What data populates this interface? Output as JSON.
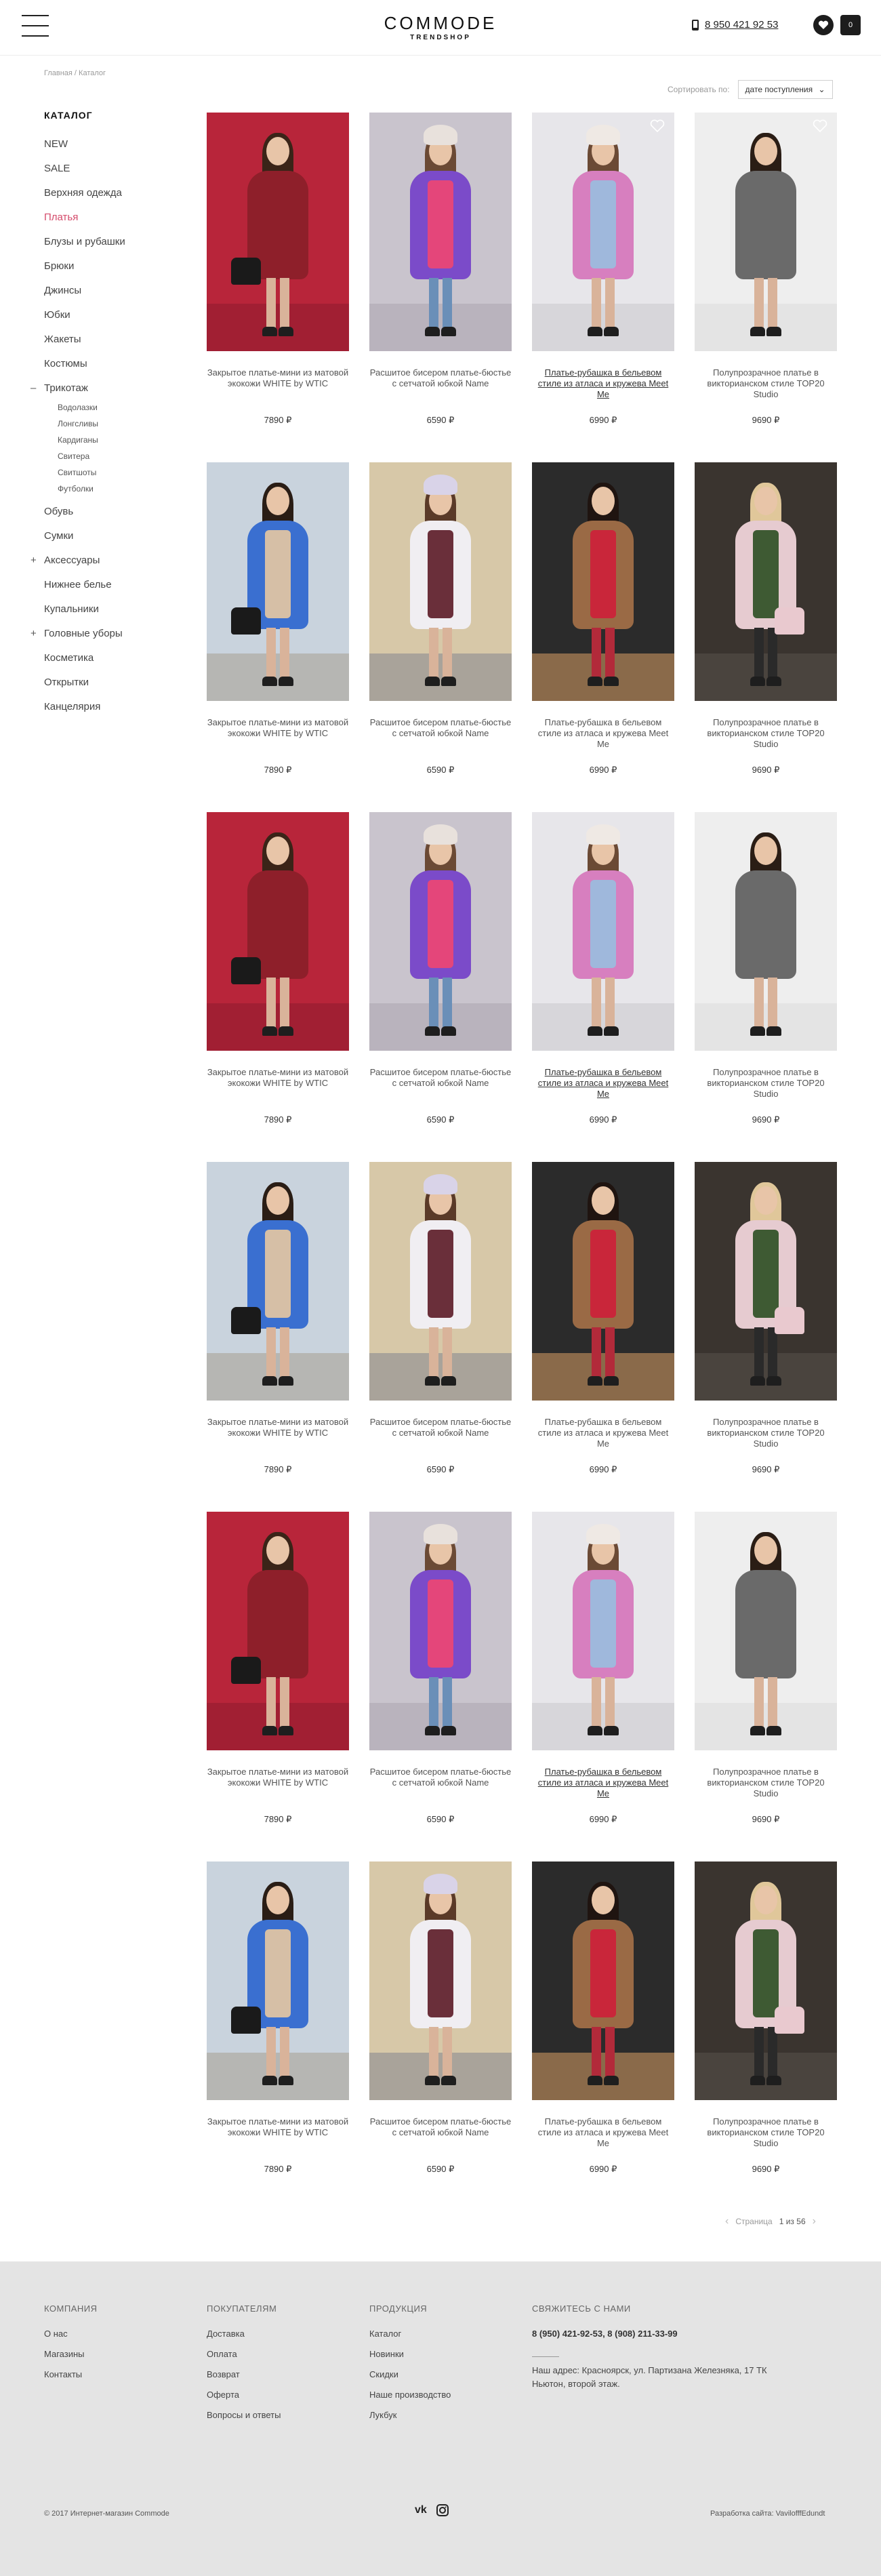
{
  "header": {
    "logo_main": "COMMODE",
    "logo_sub": "TRENDSHOP",
    "phone": "8 950 421 92 53",
    "cart_count": "0"
  },
  "breadcrumb": "Главная / Каталог",
  "sort": {
    "label": "Сортировать по:",
    "value": "дате поступления"
  },
  "sidebar": {
    "title": "КАТАЛОГ",
    "items": [
      {
        "label": "NEW",
        "sign": "",
        "active": false
      },
      {
        "label": "SALE",
        "sign": "",
        "active": false
      },
      {
        "label": "Верхняя одежда",
        "sign": "",
        "active": false
      },
      {
        "label": "Платья",
        "sign": "",
        "active": true
      },
      {
        "label": "Блузы и рубашки",
        "sign": "",
        "active": false
      },
      {
        "label": "Брюки",
        "sign": "",
        "active": false
      },
      {
        "label": "Джинсы",
        "sign": "",
        "active": false
      },
      {
        "label": "Юбки",
        "sign": "",
        "active": false
      },
      {
        "label": "Жакеты",
        "sign": "",
        "active": false
      },
      {
        "label": "Костюмы",
        "sign": "",
        "active": false
      },
      {
        "label": "Трикотаж",
        "sign": "–",
        "active": false
      }
    ],
    "subitems": [
      "Водолазки",
      "Лонгсливы",
      "Кардиганы",
      "Свитера",
      "Свитшоты",
      "Футболки"
    ],
    "items_after": [
      {
        "label": "Обувь",
        "sign": ""
      },
      {
        "label": "Сумки",
        "sign": ""
      },
      {
        "label": "Аксессуары",
        "sign": "+"
      },
      {
        "label": "Нижнее белье",
        "sign": ""
      },
      {
        "label": "Купальники",
        "sign": ""
      },
      {
        "label": "Головные уборы",
        "sign": "+"
      },
      {
        "label": "Косметика",
        "sign": ""
      },
      {
        "label": "Открытки",
        "sign": ""
      },
      {
        "label": "Канцелярия",
        "sign": ""
      }
    ]
  },
  "product_variants": {
    "a": {
      "title": "Закрытое платье-мини из матовой экокожи WHITE by WTIC",
      "price": "7890 ₽",
      "scene": "red"
    },
    "b": {
      "title": "Расшитое бисером платье-бюстье с сетчатой юбкой Name",
      "price": "6590 ₽",
      "scene": "purple"
    },
    "c": {
      "title": "Платье-рубашка в бельевом стиле из атласа и кружева Meet Me",
      "price": "6990 ₽",
      "scene": "pink"
    },
    "d": {
      "title": "Полупрозрачное платье в викторианском стиле TOP20 Studio",
      "price": "9690 ₽",
      "scene": "gray"
    },
    "e": {
      "title": "Закрытое платье-мини из матовой экокожи WHITE by WTIC",
      "price": "7890 ₽",
      "scene": "street-blue"
    },
    "f": {
      "title": "Расшитое бисером платье-бюстье с сетчатой юбкой Name",
      "price": "6590 ₽",
      "scene": "street-shirt"
    },
    "g": {
      "title": "Платье-рубашка в бельевом стиле из атласа и кружева Meet Me",
      "price": "6990 ₽",
      "scene": "coat-brown"
    },
    "h": {
      "title": "Полупрозрачное платье в викторианском стиле TOP20 Studio",
      "price": "9690 ₽",
      "scene": "coat-pink"
    }
  },
  "products": [
    {
      "v": "a",
      "link": false,
      "fav": false
    },
    {
      "v": "b",
      "link": false,
      "fav": false
    },
    {
      "v": "c",
      "link": true,
      "fav": true
    },
    {
      "v": "d",
      "link": false,
      "fav": true
    },
    {
      "v": "e",
      "link": false,
      "fav": false
    },
    {
      "v": "f",
      "link": false,
      "fav": false
    },
    {
      "v": "g",
      "link": false,
      "fav": false
    },
    {
      "v": "h",
      "link": false,
      "fav": false
    },
    {
      "v": "a",
      "link": false,
      "fav": false
    },
    {
      "v": "b",
      "link": false,
      "fav": false
    },
    {
      "v": "c",
      "link": true,
      "fav": false
    },
    {
      "v": "d",
      "link": false,
      "fav": false
    },
    {
      "v": "e",
      "link": false,
      "fav": false
    },
    {
      "v": "f",
      "link": false,
      "fav": false
    },
    {
      "v": "g",
      "link": false,
      "fav": false
    },
    {
      "v": "h",
      "link": false,
      "fav": false
    },
    {
      "v": "a",
      "link": false,
      "fav": false
    },
    {
      "v": "b",
      "link": false,
      "fav": false
    },
    {
      "v": "c",
      "link": true,
      "fav": false
    },
    {
      "v": "d",
      "link": false,
      "fav": false
    },
    {
      "v": "e",
      "link": false,
      "fav": false
    },
    {
      "v": "f",
      "link": false,
      "fav": false
    },
    {
      "v": "g",
      "link": false,
      "fav": false
    },
    {
      "v": "h",
      "link": false,
      "fav": false
    }
  ],
  "pagination": {
    "label": "Страница",
    "current": "1 из 56"
  },
  "footer": {
    "company": {
      "title": "КОМПАНИЯ",
      "items": [
        "О нас",
        "Магазины",
        "Контакты"
      ]
    },
    "buyers": {
      "title": "ПОКУПАТЕЛЯМ",
      "items": [
        "Доставка",
        "Оплата",
        "Возврат",
        "Оферта",
        "Вопросы и ответы"
      ]
    },
    "products": {
      "title": "ПРОДУКЦИЯ",
      "items": [
        "Каталог",
        "Новинки",
        "Скидки",
        "Наше производство",
        "Лукбук"
      ]
    },
    "contact": {
      "title": "СВЯЖИТЕСЬ С НАМИ",
      "phones": "8 (950) 421-92-53, 8 (908) 211-33-99",
      "address": "Наш адрес: Красноярск, ул. Партизана Железняка, 17 ТК Ньютон, второй этаж."
    },
    "copyright": "© 2017 Интернет-магазин Commode",
    "social": [
      "vk",
      "instagram"
    ],
    "developer": "Разработка сайта: VavilofffEdundt"
  }
}
